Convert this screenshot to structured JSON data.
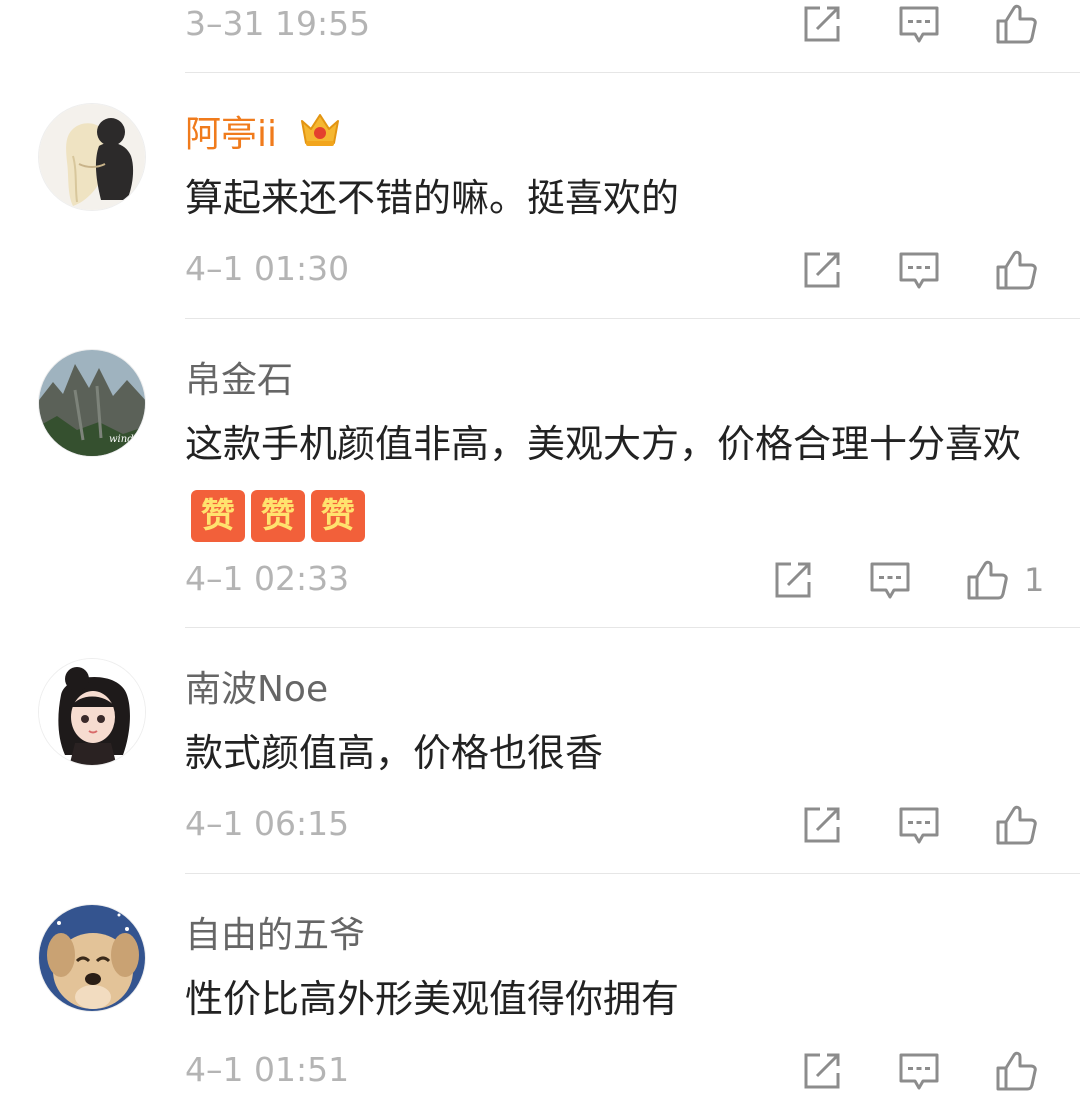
{
  "top": {
    "time": "3–31 19:55"
  },
  "comments": [
    {
      "user": "阿亭ii",
      "content": "算起来还不错的嘛。挺喜欢的",
      "time": "4–1 01:30"
    },
    {
      "user": "帛金石",
      "content": "这款手机颜值非高，美观大方，价格合理十分喜欢",
      "emoji": [
        "赞",
        "赞",
        "赞"
      ],
      "time": "4–1 02:33",
      "likes": "1"
    },
    {
      "user": "南波Noe",
      "content": "款式颜值高，价格也很香",
      "time": "4–1 06:15"
    },
    {
      "user": "自由的五爷",
      "content": "性价比高外形美观值得你拥有",
      "time": "4–1 01:51"
    }
  ],
  "icons": {
    "share": "share-icon",
    "reply": "comment-icon",
    "like": "thumbs-up-icon",
    "vip": "crown-badge-icon",
    "emoji": "zan-emoji-icon"
  },
  "colors": {
    "vip_name": "#f07b1c",
    "username": "#666666",
    "text": "#222222",
    "time": "#b4b4b4",
    "icon": "#8c8c8c"
  }
}
